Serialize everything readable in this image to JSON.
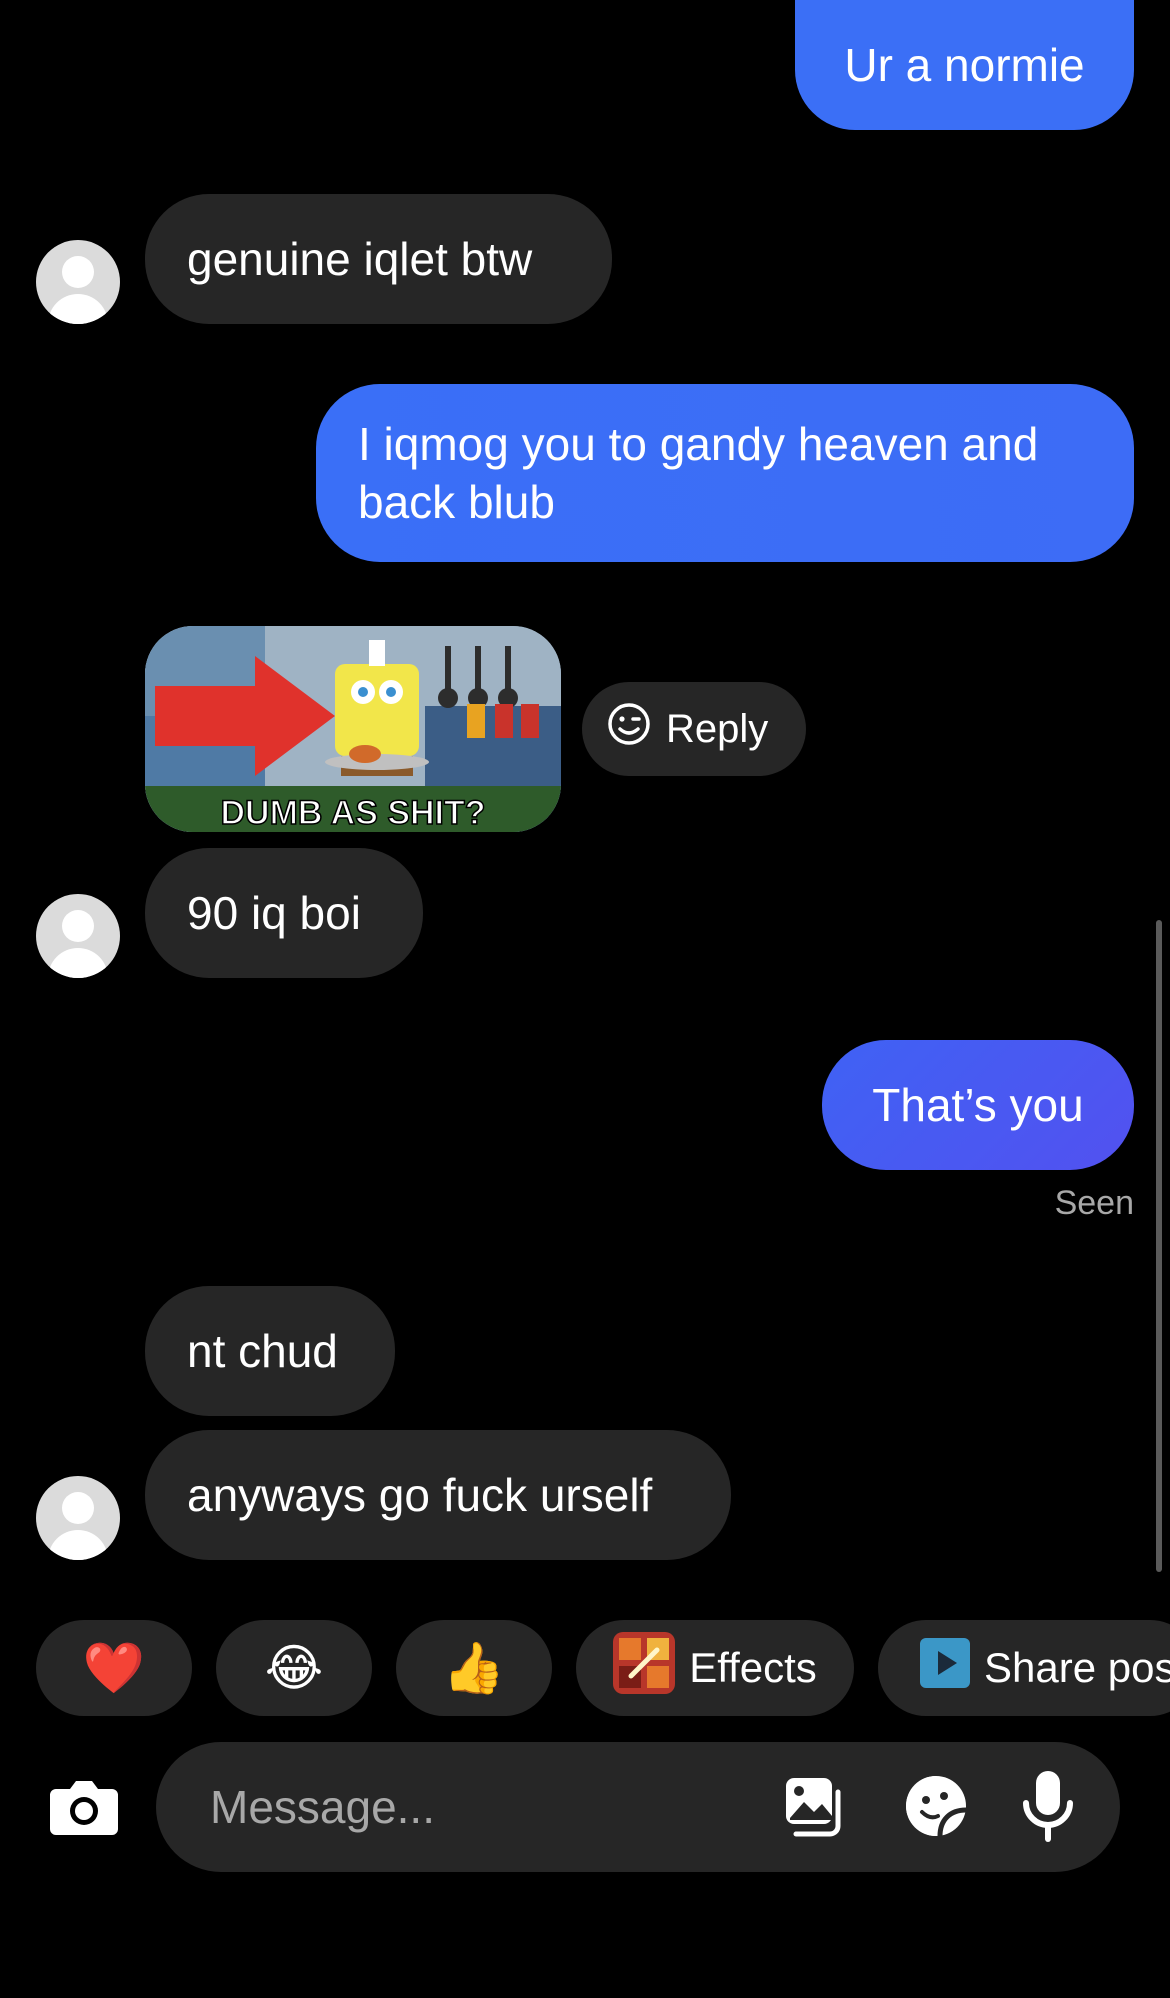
{
  "messages": [
    {
      "id": "m1",
      "direction": "outgoing",
      "text": "Ur a normie"
    },
    {
      "id": "m2",
      "direction": "incoming",
      "text": "genuine iqlet btw"
    },
    {
      "id": "m3",
      "direction": "outgoing",
      "lines": [
        "I iqmog you to gandy heaven and",
        "back blub"
      ]
    },
    {
      "id": "m4",
      "direction": "incoming",
      "type": "image",
      "caption": "DUMB AS SHIT?"
    },
    {
      "id": "m5",
      "direction": "incoming",
      "text": "90 iq boi"
    },
    {
      "id": "m6",
      "direction": "outgoing",
      "text": "That’s you"
    },
    {
      "id": "m7",
      "direction": "incoming",
      "text": "nt chud"
    },
    {
      "id": "m8",
      "direction": "incoming",
      "text": "anyways go fuck urself"
    }
  ],
  "status": {
    "seen": "Seen"
  },
  "reply_button": {
    "label": "Reply",
    "icon": "emoji-smile-icon"
  },
  "quick_replies": [
    {
      "emoji": "❤️",
      "icon": "heart-emoji"
    },
    {
      "emoji": "😂",
      "icon": "laugh-cry-emoji"
    },
    {
      "emoji": "👍",
      "icon": "thumbs-up-emoji"
    },
    {
      "label": "Effects",
      "icon": "effects-icon"
    },
    {
      "label": "Share pos",
      "icon": "share-play-icon"
    }
  ],
  "composer": {
    "placeholder": "Message...",
    "icons": [
      "camera-icon",
      "gallery-icon",
      "sticker-icon",
      "microphone-icon"
    ]
  },
  "colors": {
    "background": "#000000",
    "incoming_bubble": "#262626",
    "outgoing_gradient_start": "#3a6ff7",
    "outgoing_gradient_end": "#5151f2",
    "secondary_text": "#a8a8a8"
  }
}
